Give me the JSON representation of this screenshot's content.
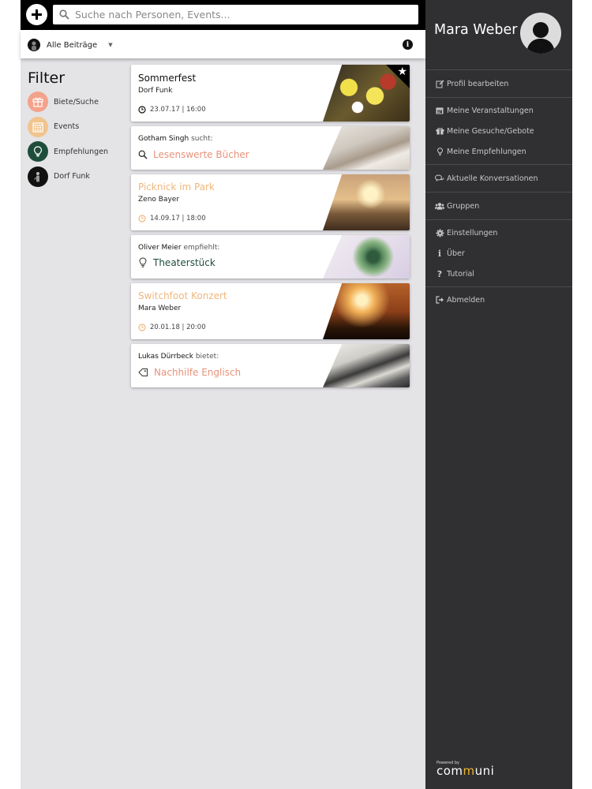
{
  "search": {
    "placeholder": "Suche nach Personen, Events..."
  },
  "filterbar": {
    "selected": "Alle Beiträge"
  },
  "filters": {
    "title": "Filter",
    "items": [
      {
        "label": "Biete/Suche",
        "icon": "gift-icon",
        "color": "#f4a28a"
      },
      {
        "label": "Events",
        "icon": "calendar-icon",
        "color": "#f2c48d"
      },
      {
        "label": "Empfehlungen",
        "icon": "lightbulb-icon",
        "color": "#1f4d3b"
      },
      {
        "label": "Dorf Funk",
        "icon": "radio-icon",
        "color": "#111111"
      }
    ]
  },
  "feed": [
    {
      "type": "event",
      "title": "Sommerfest",
      "organizer": "Dorf Funk",
      "date": "23.07.17 | 16:00",
      "starred": true,
      "title_color": "#111111"
    },
    {
      "type": "search",
      "person": "Gotham Singh",
      "verb": "sucht:",
      "item": "Lesenswerte Bücher",
      "item_color": "#e8917a"
    },
    {
      "type": "event",
      "title": "Picknick im Park",
      "organizer": "Zeno Bayer",
      "date": "14.09.17 | 18:00",
      "title_color": "#efb77d"
    },
    {
      "type": "recommend",
      "person": "Oliver Meier",
      "verb": "empfiehlt:",
      "item": "Theaterstück",
      "item_color": "#1f4d3b"
    },
    {
      "type": "event",
      "title": "Switchfoot Konzert",
      "organizer": "Mara Weber",
      "date": "20.01.18 | 20:00",
      "title_color": "#efb77d"
    },
    {
      "type": "offer",
      "person": "Lukas Dürrbeck",
      "verb": "bietet:",
      "item": "Nachhilfe Englisch",
      "item_color": "#e8917a"
    }
  ],
  "user": {
    "name": "Mara Weber"
  },
  "menu": {
    "edit_profile": "Profil bearbeiten",
    "my_events": "Meine Veranstaltungen",
    "my_offers": "Meine Gesuche/Gebote",
    "my_recommendations": "Meine Empfehlungen",
    "conversations": "Aktuelle Konversationen",
    "groups": "Gruppen",
    "settings": "Einstellungen",
    "about": "Über",
    "tutorial": "Tutorial",
    "logout": "Abmelden"
  },
  "brand": {
    "powered": "Powered by",
    "name_a": "com",
    "name_m": "m",
    "name_b": "uni"
  }
}
